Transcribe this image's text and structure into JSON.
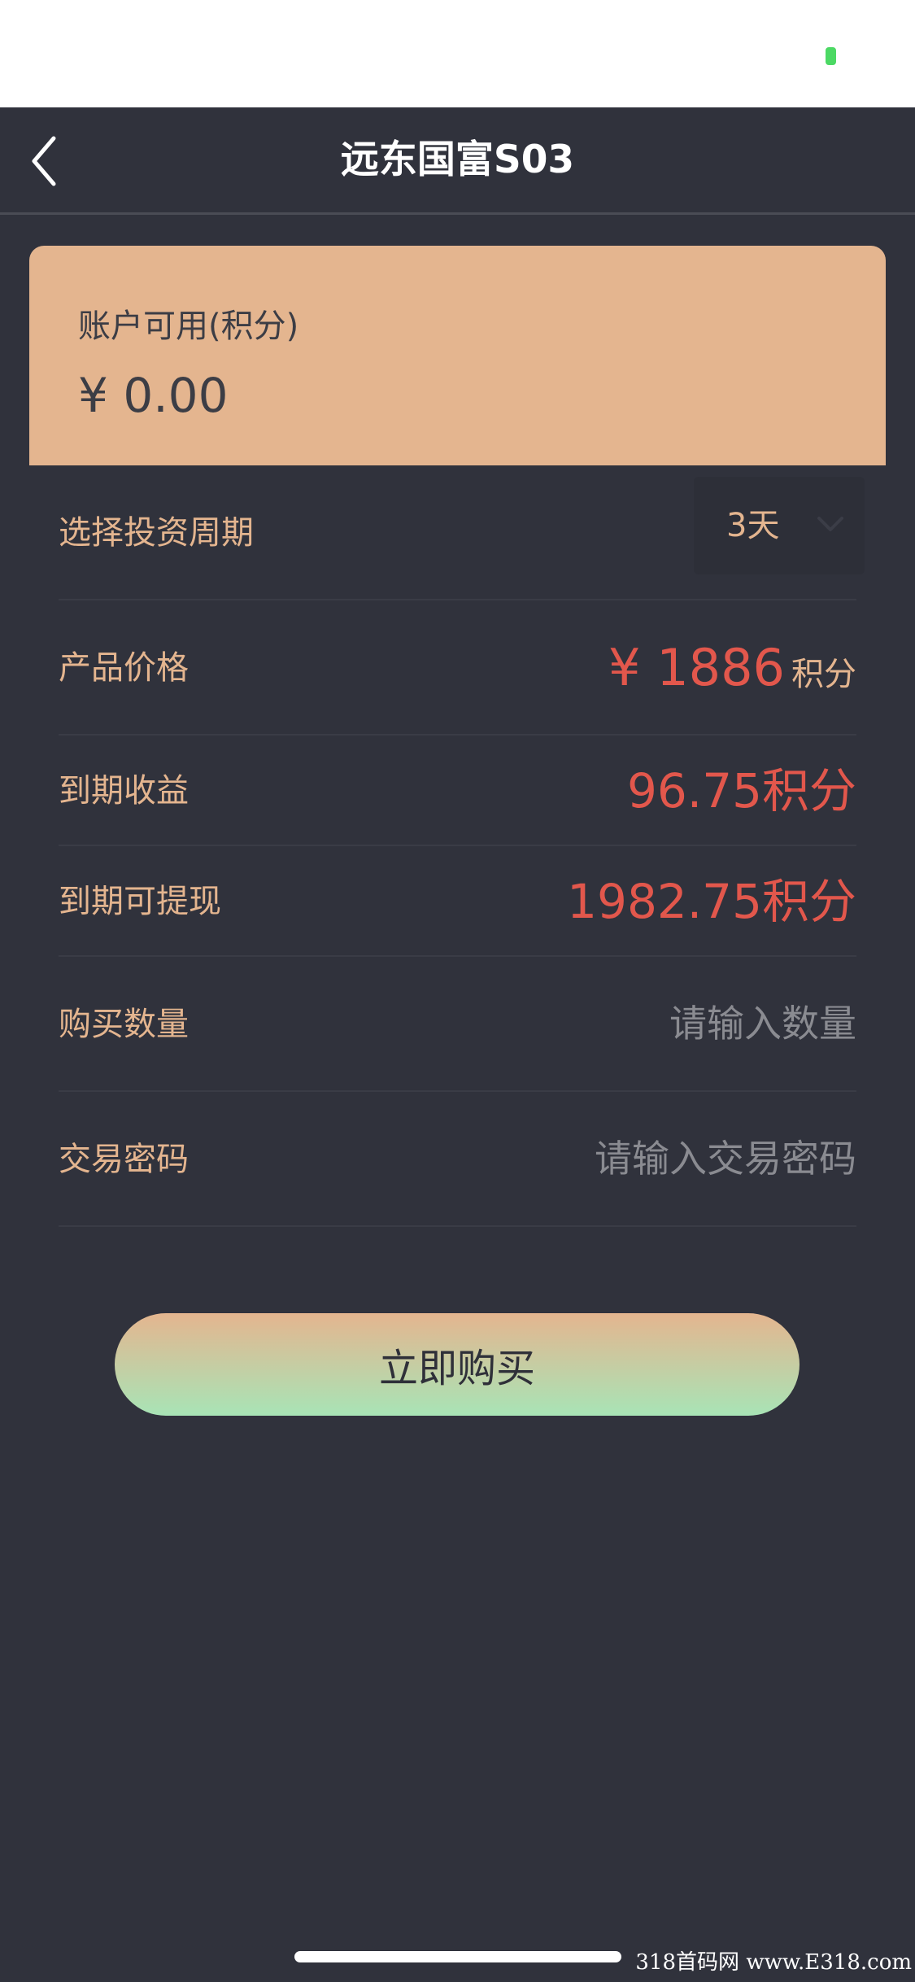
{
  "header": {
    "title": "远东国富S03",
    "back_icon": "chevron-left-icon"
  },
  "account": {
    "label": "账户可用(积分)",
    "balance": "¥ 0.00"
  },
  "period": {
    "label": "选择投资周期",
    "value": "3天",
    "icon": "chevron-down-icon"
  },
  "price": {
    "label": "产品价格",
    "value": "¥ 1886",
    "unit": "积分"
  },
  "profit": {
    "label": "到期收益",
    "value": "96.75积分"
  },
  "withdraw": {
    "label": "到期可提现",
    "value": "1982.75积分"
  },
  "quantity": {
    "label": "购买数量",
    "value": "",
    "placeholder": "请输入数量"
  },
  "password": {
    "label": "交易密码",
    "value": "",
    "placeholder": "请输入交易密码"
  },
  "buy_button": {
    "label": "立即购买"
  },
  "watermark": {
    "text": "318首码网 www.E318.com"
  },
  "colors": {
    "background": "#30323c",
    "accent": "#e4b58f",
    "value_red": "#e2574c",
    "button_gradient_end": "#a8e4b6"
  }
}
